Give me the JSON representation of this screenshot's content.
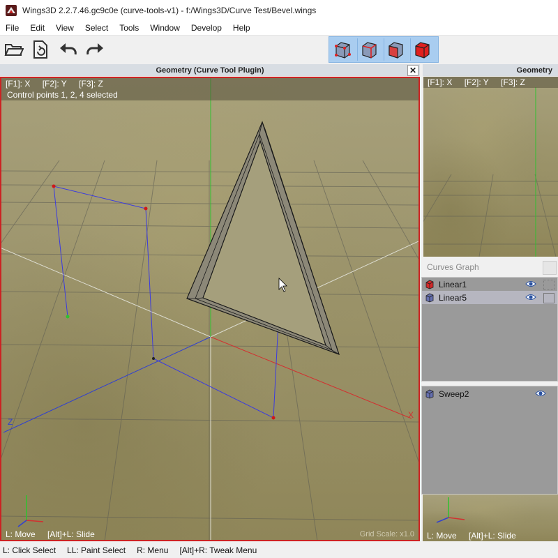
{
  "window": {
    "title": "Wings3D 2.2.7.46.gc9c0e (curve-tools-v1) - f:/Wings3D/Curve Test/Bevel.wings"
  },
  "menu": [
    "File",
    "Edit",
    "View",
    "Select",
    "Tools",
    "Window",
    "Develop",
    "Help"
  ],
  "toolbar": {
    "icons": [
      "open-folder-icon",
      "save-icon",
      "undo-icon",
      "redo-icon"
    ],
    "selection_modes": [
      "vertex-mode-icon",
      "edge-mode-icon",
      "face-mode-icon",
      "body-mode-icon"
    ]
  },
  "viewport_main": {
    "title": "Geometry (Curve Tool Plugin)",
    "axis_keys": [
      "[F1]: X",
      "[F2]: Y",
      "[F3]: Z"
    ],
    "message": "Control points 1, 2, 4 selected",
    "status": [
      "L: Move",
      "[Alt]+L: Slide"
    ],
    "grid_scale": "Grid Scale: x1.0",
    "axis_labels": {
      "x": "X",
      "z": "Z"
    }
  },
  "viewport_side": {
    "title": "Geometry",
    "axis_keys": [
      "[F1]: X",
      "[F2]: Y",
      "[F3]: Z"
    ],
    "status": [
      "L: Move",
      "[Alt]+L: Slide"
    ]
  },
  "curves_graph": {
    "title": "Curves Graph",
    "items": [
      {
        "label": "Linear1",
        "color": "#d42a2a"
      },
      {
        "label": "Linear5",
        "color": "#6670b0"
      }
    ]
  },
  "objects": {
    "items": [
      {
        "label": "Sweep2",
        "color": "#6670b0"
      }
    ]
  },
  "statusbar": [
    "L: Click Select",
    "LL: Paint Select",
    "R: Menu",
    "[Alt]+R: Tweak Menu"
  ]
}
